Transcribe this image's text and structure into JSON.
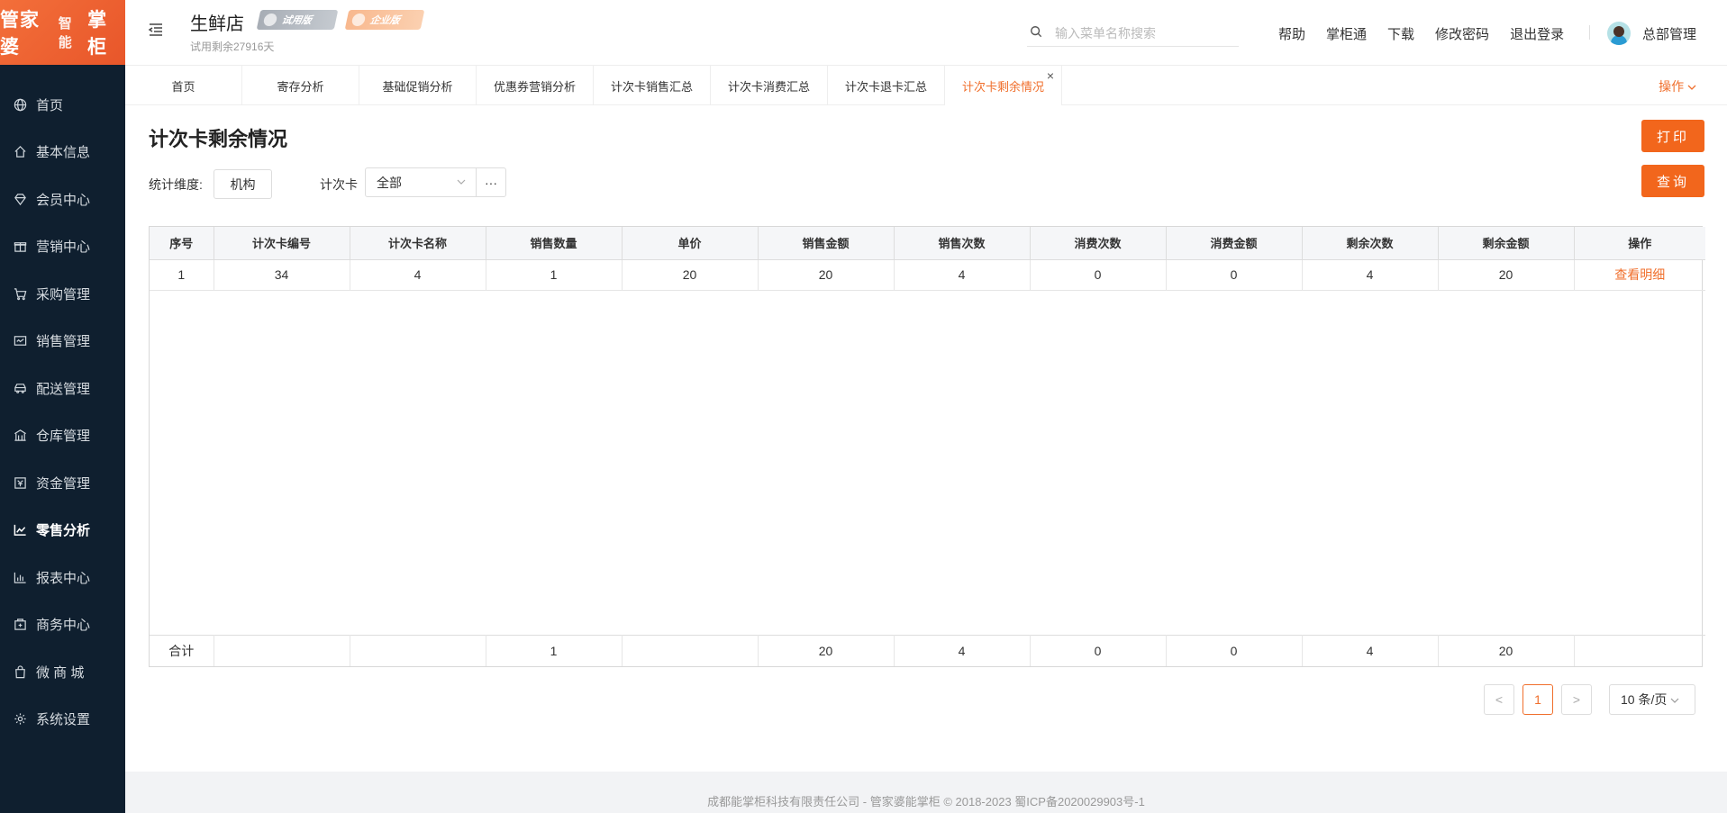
{
  "logo": {
    "main": "管家婆",
    "sub": "智能",
    "tail": "掌柜"
  },
  "sidebar": {
    "items": [
      {
        "label": "首页",
        "icon": "globe-icon"
      },
      {
        "label": "基本信息",
        "icon": "home-icon"
      },
      {
        "label": "会员中心",
        "icon": "diamond-icon"
      },
      {
        "label": "营销中心",
        "icon": "gift-icon"
      },
      {
        "label": "采购管理",
        "icon": "cart-icon"
      },
      {
        "label": "销售管理",
        "icon": "sales-icon"
      },
      {
        "label": "配送管理",
        "icon": "car-icon"
      },
      {
        "label": "仓库管理",
        "icon": "warehouse-icon"
      },
      {
        "label": "资金管理",
        "icon": "money-icon"
      },
      {
        "label": "零售分析",
        "icon": "chart-icon",
        "active": true
      },
      {
        "label": "报表中心",
        "icon": "report-icon"
      },
      {
        "label": "商务中心",
        "icon": "business-icon"
      },
      {
        "label": "微 商 城",
        "icon": "bag-icon"
      },
      {
        "label": "系统设置",
        "icon": "gear-icon"
      }
    ]
  },
  "header": {
    "store_name": "生鲜店",
    "badge_trial": "试用版",
    "badge_enterprise": "企业版",
    "trial_days": "试用剩余27916天",
    "search_placeholder": "输入菜单名称搜索",
    "links": [
      "帮助",
      "掌柜通",
      "下载",
      "修改密码",
      "退出登录"
    ],
    "user_name": "总部管理"
  },
  "tabs": {
    "items": [
      {
        "label": "首页"
      },
      {
        "label": "寄存分析"
      },
      {
        "label": "基础促销分析"
      },
      {
        "label": "优惠券营销分析"
      },
      {
        "label": "计次卡销售汇总"
      },
      {
        "label": "计次卡消费汇总"
      },
      {
        "label": "计次卡退卡汇总"
      },
      {
        "label": "计次卡剩余情况",
        "active": true
      }
    ],
    "close_label": "×",
    "ops_label": "操作"
  },
  "main": {
    "title": "计次卡剩余情况",
    "print_label": "打印",
    "query_label": "查询",
    "dimension_label": "统计维度:",
    "dimension_value": "机构",
    "card_label": "计次卡",
    "card_value": "全部",
    "more_label": "···"
  },
  "table": {
    "headers": [
      "序号",
      "计次卡编号",
      "计次卡名称",
      "销售数量",
      "单价",
      "销售金额",
      "销售次数",
      "消费次数",
      "消费金额",
      "剩余次数",
      "剩余金额",
      "操作"
    ],
    "rows": [
      [
        "1",
        "34",
        "4",
        "1",
        "20",
        "20",
        "4",
        "0",
        "0",
        "4",
        "20",
        "查看明细"
      ]
    ],
    "totals": [
      "合计",
      "",
      "",
      "1",
      "",
      "20",
      "4",
      "0",
      "0",
      "4",
      "20",
      ""
    ]
  },
  "pagination": {
    "prev": "<",
    "current": "1",
    "next": ">",
    "page_size": "10 条/页"
  },
  "footer": {
    "text": "成都能掌柜科技有限责任公司 - 管家婆能掌柜 © 2018-2023 蜀ICP备2020029903号-1"
  }
}
